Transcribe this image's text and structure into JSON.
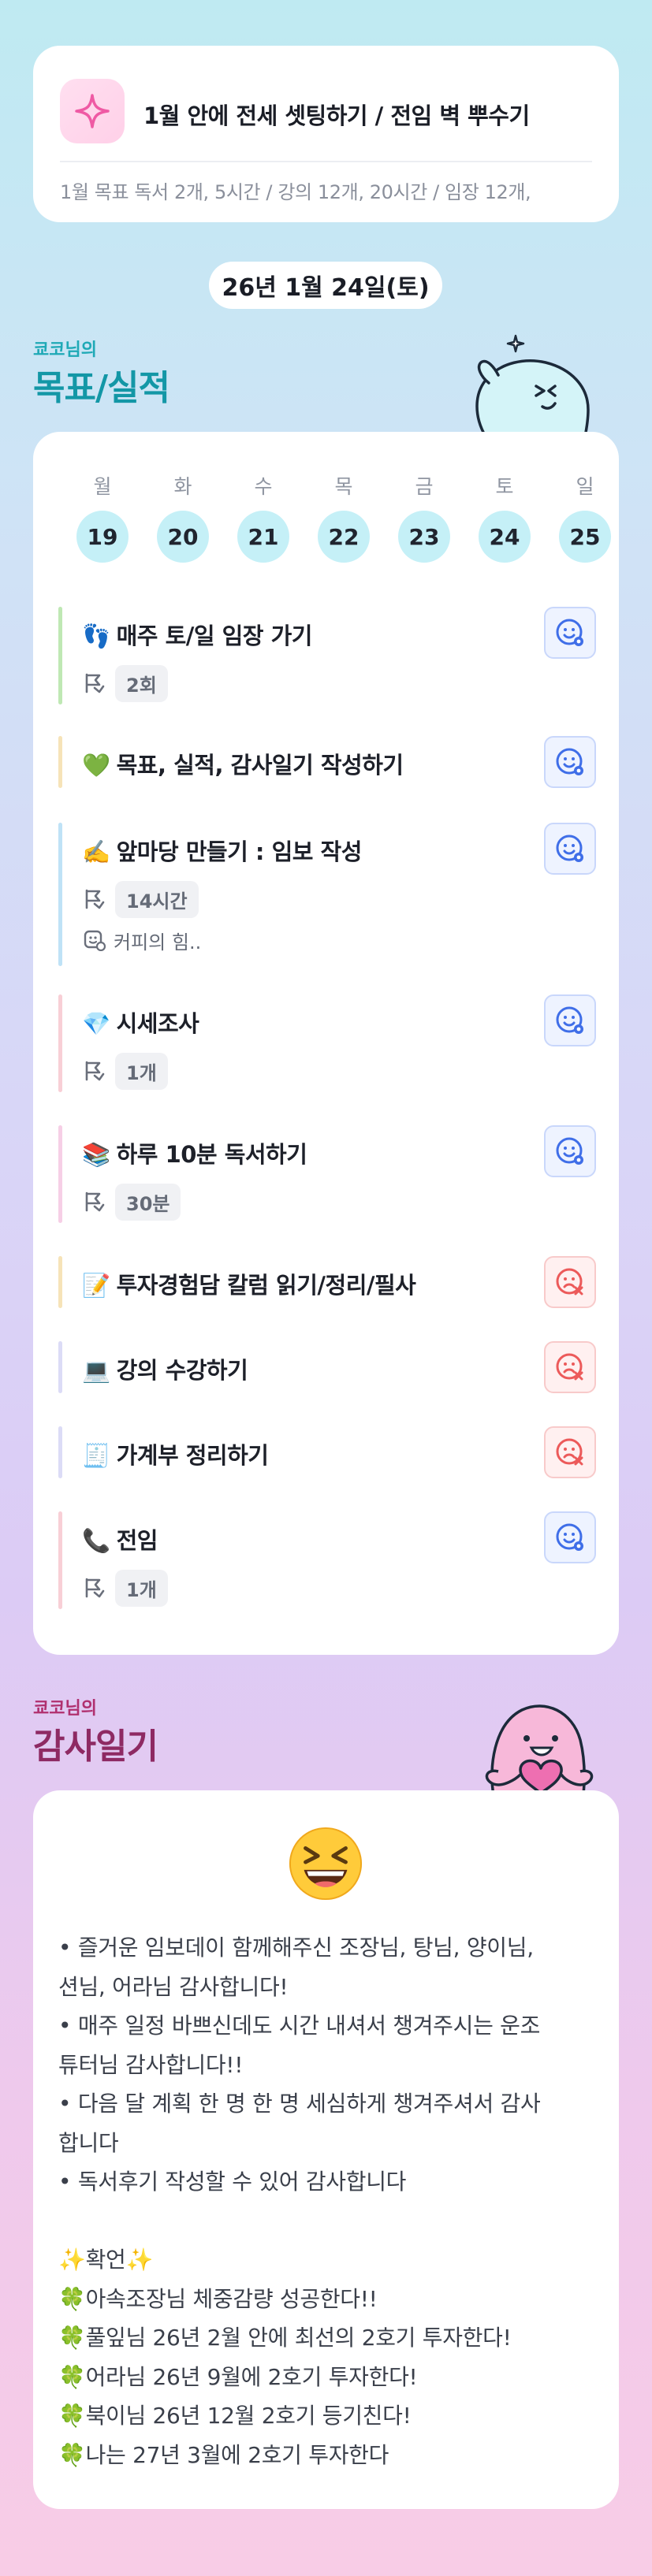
{
  "header": {
    "title": "1월 안에 전세 셋팅하기 / 전임 벽 뿌수기",
    "subtitle": "1월 목표  독서 2개, 5시간 / 강의 12개, 20시간 / 임장 12개,"
  },
  "date": "26년 1월 24일(토)",
  "goals_section": {
    "owner": "쿄코님의",
    "title": "목표/실적"
  },
  "week": {
    "days": [
      "월",
      "화",
      "수",
      "목",
      "금",
      "토",
      "일"
    ],
    "dates": [
      "19",
      "20",
      "21",
      "22",
      "23",
      "24",
      "25"
    ]
  },
  "goals": [
    {
      "emoji": "👣",
      "label": "매주 토/일 임장 가기",
      "chip": "2회",
      "note": "",
      "status": "done",
      "bar_color": "#bfe8b4"
    },
    {
      "emoji": "💚",
      "label": "목표, 실적, 감사일기 작성하기",
      "chip": "",
      "note": "",
      "status": "done",
      "bar_color": "#f6e3b8"
    },
    {
      "emoji": "✍️",
      "label": "앞마당 만들기 : 임보 작성",
      "chip": "14시간",
      "note": "커피의 힘..",
      "status": "done",
      "bar_color": "#bfe2f6"
    },
    {
      "emoji": "💎",
      "label": "시세조사",
      "chip": "1개",
      "note": "",
      "status": "done",
      "bar_color": "#f8cfd6"
    },
    {
      "emoji": "📚",
      "label": "하루 10분 독서하기",
      "chip": "30분",
      "note": "",
      "status": "done",
      "bar_color": "#f6cfe6"
    },
    {
      "emoji": "📝",
      "label": "투자경험담 칼럼 읽기/정리/필사",
      "chip": "",
      "note": "",
      "status": "fail",
      "bar_color": "#f6e3b8"
    },
    {
      "emoji": "💻",
      "label": "강의 수강하기",
      "chip": "",
      "note": "",
      "status": "fail",
      "bar_color": "#dcdcf6"
    },
    {
      "emoji": "🧾",
      "label": "가계부 정리하기",
      "chip": "",
      "note": "",
      "status": "fail",
      "bar_color": "#dcdcf6"
    },
    {
      "emoji": "📞",
      "label": "전임",
      "chip": "1개",
      "note": "",
      "status": "done",
      "bar_color": "#f8cfd6"
    }
  ],
  "gratitude_section": {
    "owner": "쿄코님의",
    "title": "감사일기"
  },
  "gratitude": {
    "emoji": "grinning-squint-face",
    "lines": [
      "• 즐거운 임보데이 함께해주신 조장님, 탕님, 양이님,",
      "션님, 어라님 감사합니다!",
      "• 매주 일정 바쁘신데도 시간 내셔서 챙겨주시는 운조",
      "튜터님 감사합니다!!",
      "• 다음 달 계획 한 명 한 명 세심하게 챙겨주셔서 감사",
      "합니다",
      "• 독서후기 작성할 수 있어 감사합니다",
      "",
      "✨확언✨",
      "🍀아속조장님 체중감량 성공한다!!",
      "🍀풀잎님 26년 2월 안에 최선의 2호기 투자한다!",
      "🍀어라님 26년 9월에 2호기 투자한다!",
      "🍀북이님 26년 12월 2호기 등기친다!",
      "🍀나는 27년 3월에 2호기 투자한다"
    ]
  },
  "colors": {
    "accent_teal": "#1fa9b6",
    "accent_magenta": "#b0306f",
    "done_blue": "#3f6ee8",
    "fail_red": "#ec5a5a"
  }
}
